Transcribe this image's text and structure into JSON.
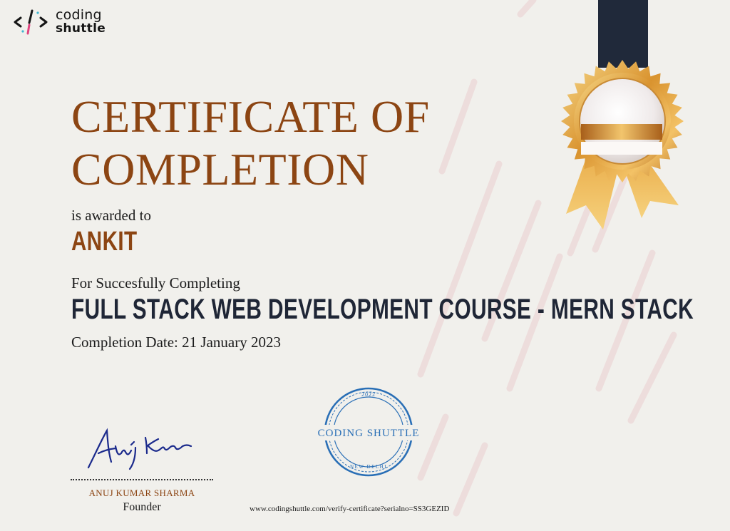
{
  "logo": {
    "line1": "coding",
    "line2": "shuttle",
    "icon": "code-brackets-icon"
  },
  "certificate": {
    "title_line1": "CERTIFICATE OF",
    "title_line2": "COMPLETION",
    "awarded_text": "is awarded to",
    "recipient": "ANKIT",
    "for_text": "For Succesfully Completing",
    "course": "FULL STACK WEB DEVELOPMENT COURSE - MERN STACK",
    "completion_label": "Completion Date:",
    "completion_date": "21 January 2023"
  },
  "signatory": {
    "name": "ANUJ KUMAR SHARMA",
    "role": "Founder"
  },
  "stamp": {
    "year": "2022",
    "name": "CODING SHUTTLE",
    "city": "NEW DELHI"
  },
  "verify_url": "www.codingshuttle.com/verify-certificate?serialno=SS3GEZID",
  "colors": {
    "accent": "#8c4513",
    "navy": "#1f2636",
    "stamp_blue": "#2a6fb6",
    "background": "#f1f0ec"
  }
}
